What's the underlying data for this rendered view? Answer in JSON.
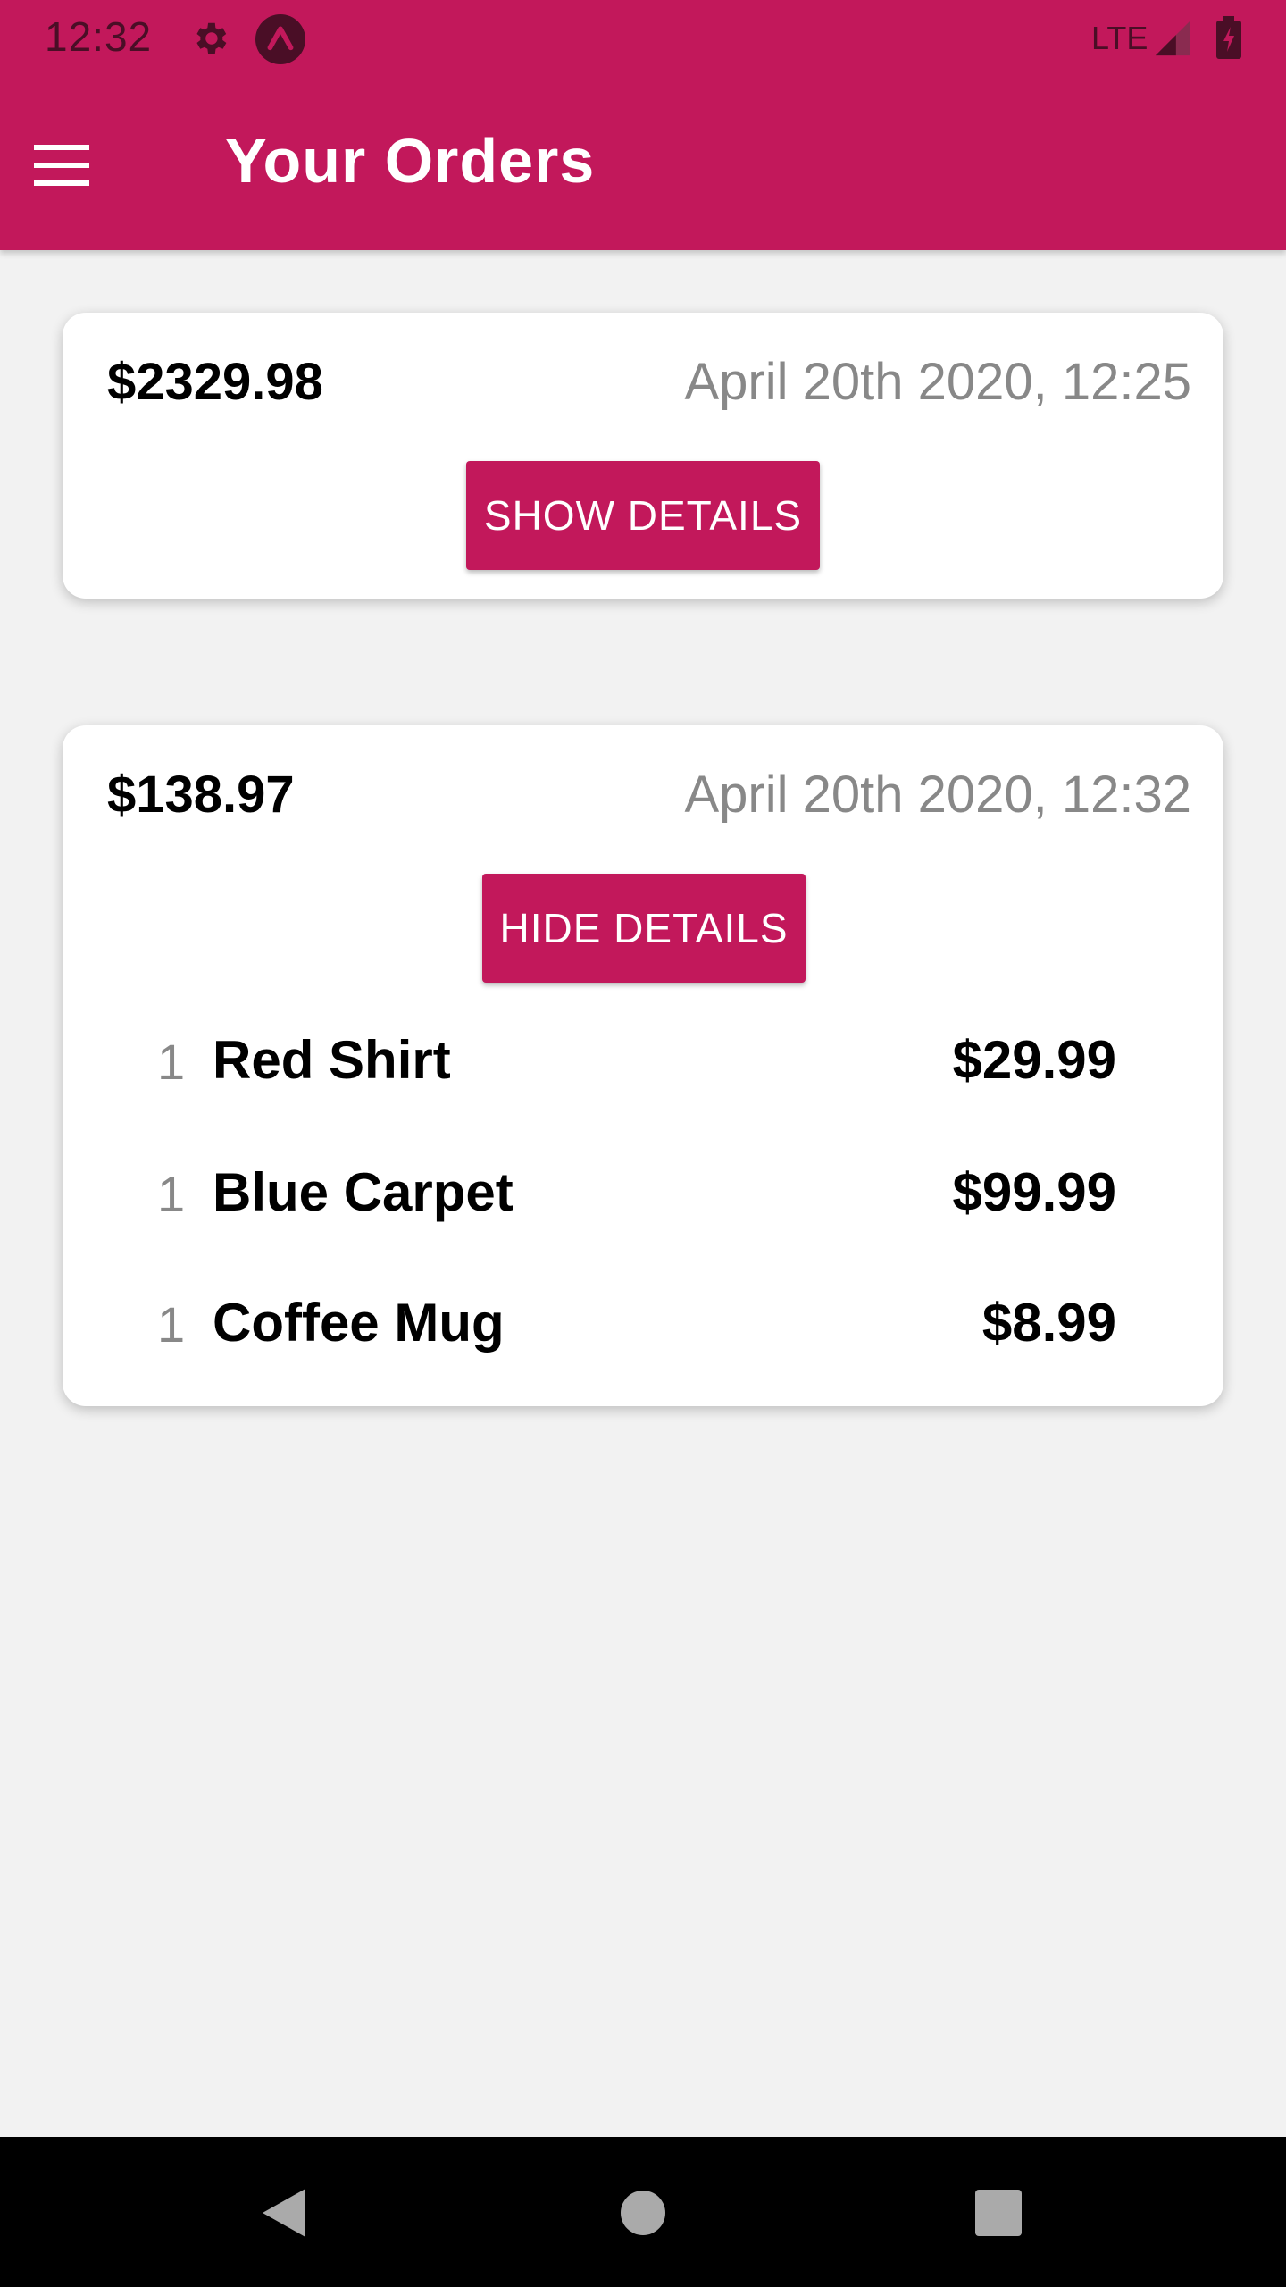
{
  "status_bar": {
    "time": "12:32",
    "network": "LTE",
    "icons": [
      "gear-icon",
      "expo-icon",
      "signal-icon",
      "battery-charging-icon"
    ]
  },
  "header": {
    "title": "Your Orders",
    "menu_icon": "hamburger-menu-icon",
    "background_color": "#c2185b"
  },
  "orders": [
    {
      "total": "$2329.98",
      "date": "April 20th 2020, 12:25",
      "button_label": "SHOW DETAILS",
      "items": []
    },
    {
      "total": "$138.97",
      "date": "April 20th 2020, 12:32",
      "button_label": "HIDE DETAILS",
      "items": [
        {
          "quantity": "1",
          "name": "Red Shirt",
          "price": "$29.99"
        },
        {
          "quantity": "1",
          "name": "Blue Carpet",
          "price": "$99.99"
        },
        {
          "quantity": "1",
          "name": "Coffee Mug",
          "price": "$8.99"
        }
      ]
    }
  ],
  "navigation": {
    "icons": [
      "back-icon",
      "home-icon",
      "recent-apps-icon"
    ]
  },
  "colors": {
    "accent": "#c2185b",
    "background": "#f2f2f2",
    "secondary_text": "#888888"
  }
}
